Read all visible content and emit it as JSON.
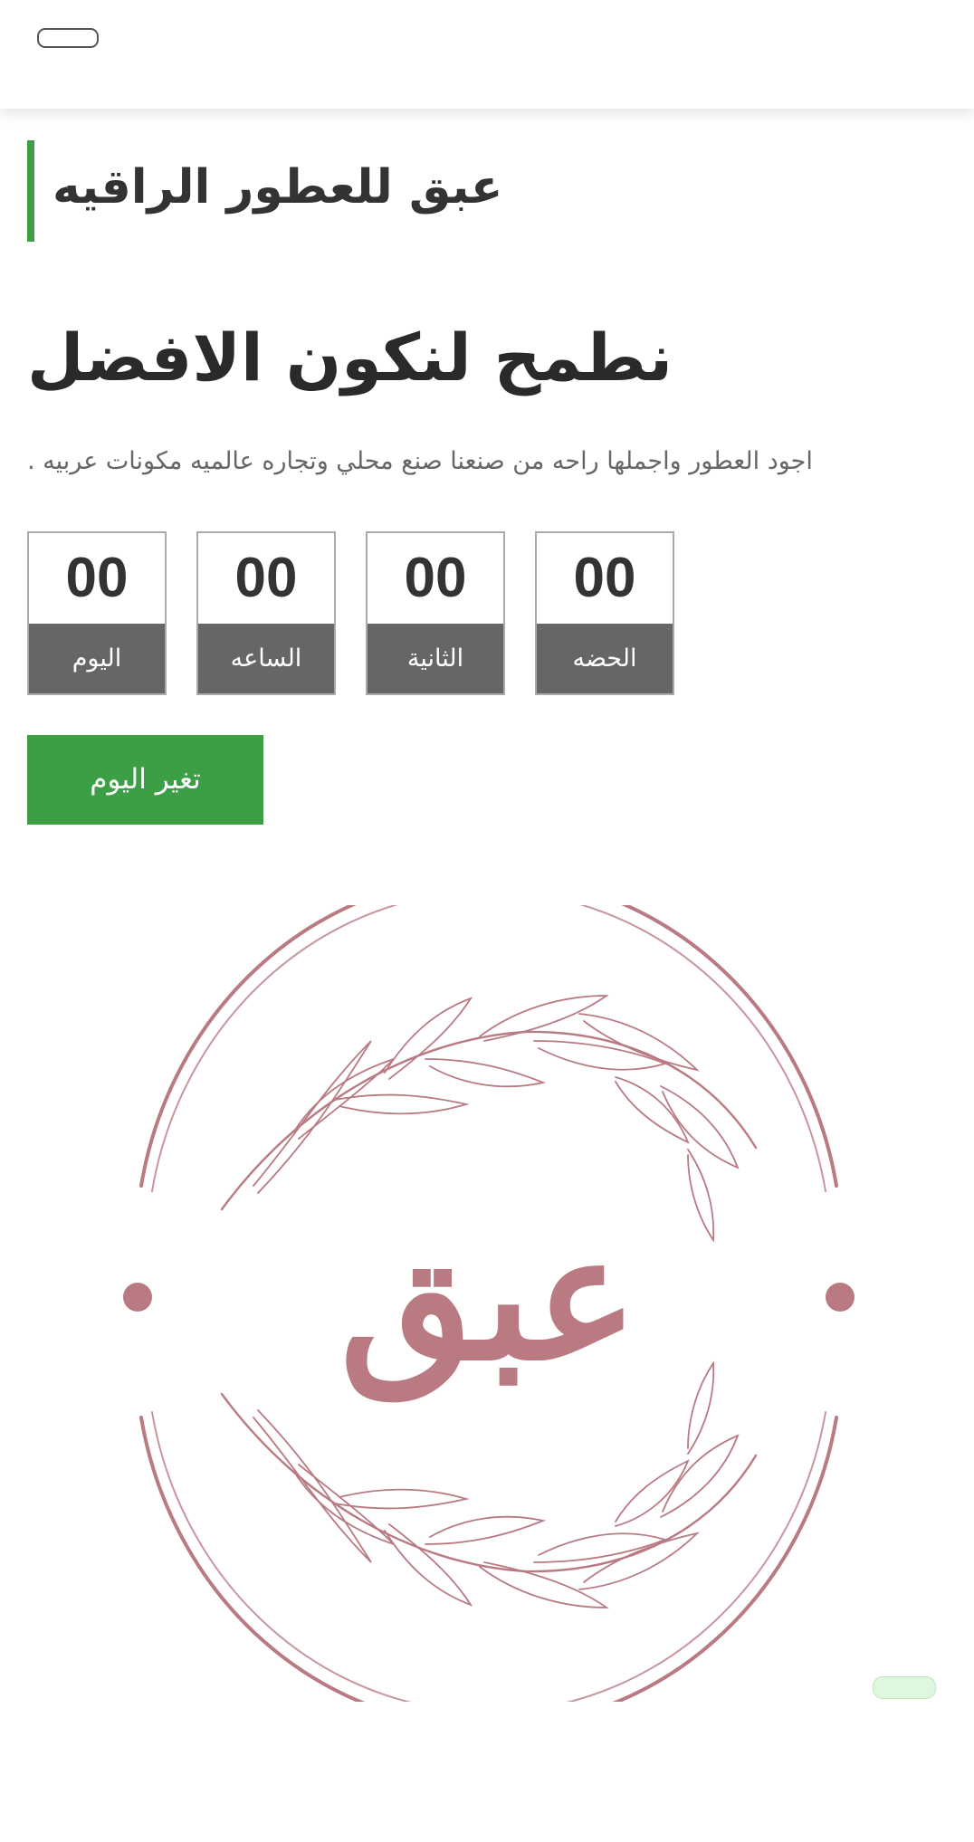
{
  "header": {
    "menu_toggle_icon": "hamburger-toggle-icon"
  },
  "brand": {
    "title": "عبق للعطور الراقيه",
    "accent_color": "#3c9e45"
  },
  "hero": {
    "headline": "نطمح لنكون الافضل",
    "subtext": "اجود العطور واجملها راحه من صنعنا صنع محلي وتجاره عالميه مكونات عربيه ."
  },
  "countdown": [
    {
      "value": "00",
      "label": "اليوم"
    },
    {
      "value": "00",
      "label": "الساعه"
    },
    {
      "value": "00",
      "label": "الثانية"
    },
    {
      "value": "00",
      "label": "الحضه"
    }
  ],
  "cta": {
    "label": "تغير اليوم",
    "color": "#3c9e45"
  },
  "logo": {
    "text": "عبق",
    "color": "#b97a82",
    "icon": "laurel-wreath-logo-icon"
  },
  "floating_widget": {
    "icon": "chat-pill-icon",
    "color": "#dff7df"
  }
}
